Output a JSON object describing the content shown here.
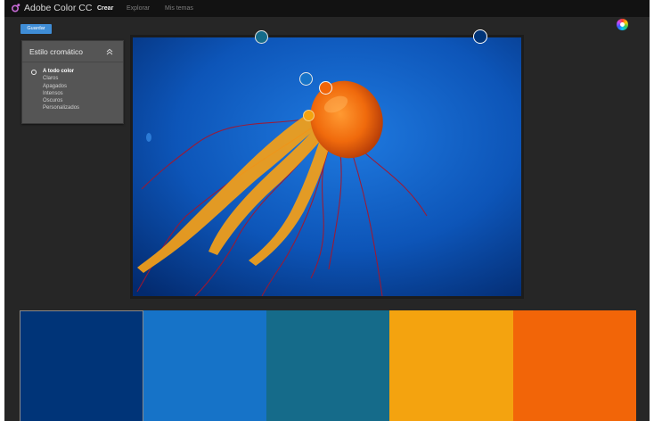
{
  "header": {
    "app_title": "Adobe Color CC",
    "tabs": [
      {
        "label": "Crear",
        "active": true
      },
      {
        "label": "Explorar",
        "active": false
      },
      {
        "label": "Mis temas",
        "active": false
      }
    ],
    "logo_icon": "adobe-color-logo-icon",
    "wheel_icon": "color-wheel-icon"
  },
  "toolbar": {
    "save_label": "Guardar"
  },
  "style_panel": {
    "title": "Estilo cromático",
    "collapse_icon": "chevron-up-icon",
    "items": [
      {
        "label": "A todo color",
        "selected": true
      },
      {
        "label": "Claros",
        "selected": false
      },
      {
        "label": "Apagados",
        "selected": false
      },
      {
        "label": "Intensos",
        "selected": false
      },
      {
        "label": "Oscuros",
        "selected": false
      },
      {
        "label": "Personalizados",
        "selected": false
      }
    ]
  },
  "palette": [
    {
      "color": "#003478",
      "active": true
    },
    {
      "color": "#1673C8",
      "active": false
    },
    {
      "color": "#156B8A",
      "active": false
    },
    {
      "color": "#F4A30F",
      "active": false
    },
    {
      "color": "#F26508",
      "active": false
    }
  ],
  "pickers": [
    {
      "color": "#156B8A"
    },
    {
      "color": "#003478"
    },
    {
      "color": "#1673C8"
    },
    {
      "color": "#F26508"
    },
    {
      "color": "#F4A30F"
    }
  ],
  "colors": {
    "accent": "#3F8DD6",
    "background": "#262626",
    "topbar": "#121212"
  }
}
